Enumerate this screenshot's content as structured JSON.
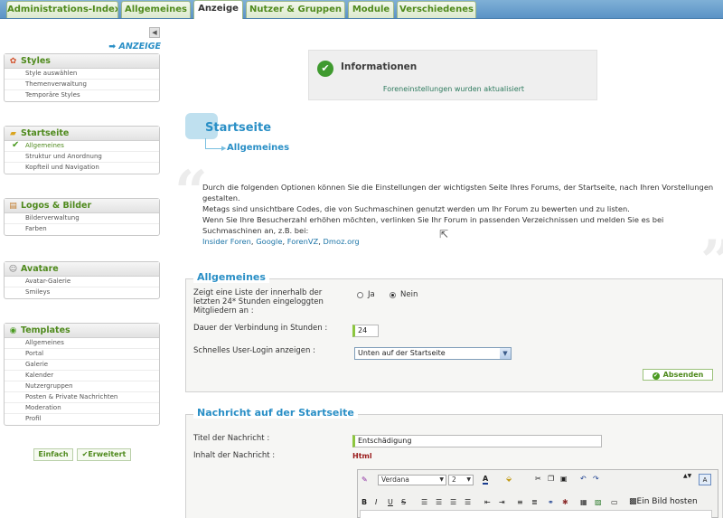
{
  "tabs": [
    "Administrations-Index",
    "Allgemeines",
    "Anzeige",
    "Nutzer & Gruppen",
    "Module",
    "Verschiedenes"
  ],
  "sidebar": {
    "collapse_glyph": "◀",
    "section_label": "➡ ANZEIGE",
    "groups": [
      {
        "title": "Styles",
        "icon": "palette-icon",
        "items": [
          "Style auswählen",
          "Themenverwaltung",
          "Temporäre Styles"
        ]
      },
      {
        "title": "Startseite",
        "icon": "folder-icon",
        "items": [
          "Allgemeines",
          "Struktur und Anordnung",
          "Kopfteil und Navigation"
        ]
      },
      {
        "title": "Logos & Bilder",
        "icon": "images-icon",
        "items": [
          "Bilderverwaltung",
          "Farben"
        ]
      },
      {
        "title": "Avatare",
        "icon": "avatar-icon",
        "items": [
          "Avatar-Galerie",
          "Smileys"
        ]
      },
      {
        "title": "Templates",
        "icon": "templates-icon",
        "items": [
          "Allgemeines",
          "Portal",
          "Galerie",
          "Kalender",
          "Nutzergruppen",
          "Posten & Private Nachrichten",
          "Moderation",
          "Profil"
        ]
      }
    ],
    "mode_simple": "Einfach",
    "mode_advanced": "Erweitert"
  },
  "info": {
    "title": "Informationen",
    "message": "Foreneinstellungen wurden aktualisiert"
  },
  "heading": {
    "title": "Startseite",
    "subtitle": "Allgemeines"
  },
  "description": {
    "line1": "Durch die folgenden Optionen können Sie die Einstellungen der wichtigsten Seite Ihres Forums, der Startseite, nach Ihren Vorstellungen gestalten.",
    "line2": "Metags sind unsichtbare Codes, die von Suchmaschinen genutzt werden um Ihr Forum zu bewerten und zu listen.",
    "line3": "Wenn Sie Ihre Besucherzahl erhöhen möchten, verlinken Sie Ihr Forum in passenden Verzeichnissen und melden Sie es bei Suchmaschinen an, z.B. bei:",
    "links": [
      "Insider Foren",
      "Google",
      "ForenVZ",
      "Dmoz.org"
    ]
  },
  "general": {
    "legend": "Allgemeines",
    "show_list_label": "Zeigt eine Liste der innerhalb der letzten 24* Stunden eingeloggten Mitgliedern an :",
    "yes": "Ja",
    "no": "Nein",
    "selected": "Nein",
    "duration_label": "Dauer der Verbindung in Stunden :",
    "duration_value": "24",
    "quick_login_label": "Schnelles User-Login anzeigen :",
    "quick_login_value": "Unten auf der Startseite",
    "submit": "Absenden"
  },
  "message": {
    "legend": "Nachricht auf der Startseite",
    "title_label": "Titel der Nachricht :",
    "title_value": "Entschädigung",
    "content_label": "Inhalt der Nachricht :",
    "html_badge": "Html",
    "font": "Verdana",
    "size": "2",
    "upload_label": "Ein Bild hosten"
  }
}
